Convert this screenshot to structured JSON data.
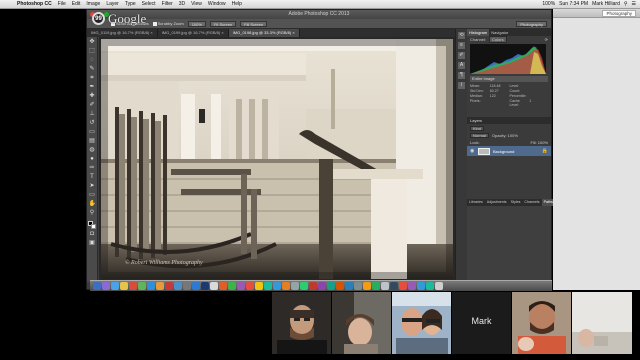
{
  "menubar": {
    "apple": "",
    "app_name": "Photoshop CC",
    "items": [
      "File",
      "Edit",
      "Image",
      "Layer",
      "Type",
      "Select",
      "Filter",
      "3D",
      "View",
      "Window",
      "Help"
    ],
    "time": "Sun 7:34 PM",
    "user": "Mark Hilliard",
    "battery": "100%"
  },
  "hangout": {
    "count": "99",
    "brand": "Google"
  },
  "photoshop": {
    "title": "Adobe Photoshop CC 2013",
    "options": {
      "scroll_all_windows": "Scroll All Windows",
      "scrubby_zoom": "Scrubby Zoom",
      "btn_100": "100%",
      "fit_screen": "Fit Screen",
      "fill_screen": "Fill Screen",
      "workspace": "Photography"
    },
    "tabs": [
      {
        "label": "IMG_0119.jpg @ 16.7% (RGB/8) ×",
        "active": false
      },
      {
        "label": "IMG_0199.jpg @ 16.7% (RGB/8) ×",
        "active": false
      },
      {
        "label": "IMG_0198.jpg @ 33.3% (RGB/8) ×",
        "active": true
      }
    ],
    "status": "33.33%     Doc: 24.8M/24.8M",
    "watermark": "© Robert Williams Photography"
  },
  "panels": {
    "top_tabs": [
      "Histogram",
      "Navigator"
    ],
    "channel_label": "Channel:",
    "channel_value": "Colors",
    "source": "Entire Image",
    "stats": [
      "Mean:",
      "118.48",
      "Level:",
      "",
      "Std Dev:",
      "60.27",
      "Count:",
      "",
      "Median:",
      "122",
      "Percentile:",
      "",
      "Pixels:",
      "",
      "Cache Level:",
      "1"
    ],
    "layers_title": "Layers",
    "kind": "Kind",
    "mode": "Normal",
    "opacity": "Opacity: 100%",
    "lock": "Lock:",
    "fill": "Fill: 100%",
    "layer_name": "Background",
    "bottom_tabs": [
      "Libraries",
      "Adjustments",
      "Styles",
      "Channels",
      "Paths"
    ]
  },
  "finder": {
    "workspace_select": "Photography"
  },
  "participants": [
    {
      "name": "",
      "has_video": true
    },
    {
      "name": "",
      "has_video": true
    },
    {
      "name": "",
      "has_video": true
    },
    {
      "name": "Mark",
      "has_video": false
    },
    {
      "name": "",
      "has_video": true
    },
    {
      "name": "",
      "has_video": true
    }
  ],
  "colors": {
    "menubar": "#e0e0e0",
    "ps_chrome": "#3c3c3c",
    "layer_selected": "#4f6a8c"
  }
}
